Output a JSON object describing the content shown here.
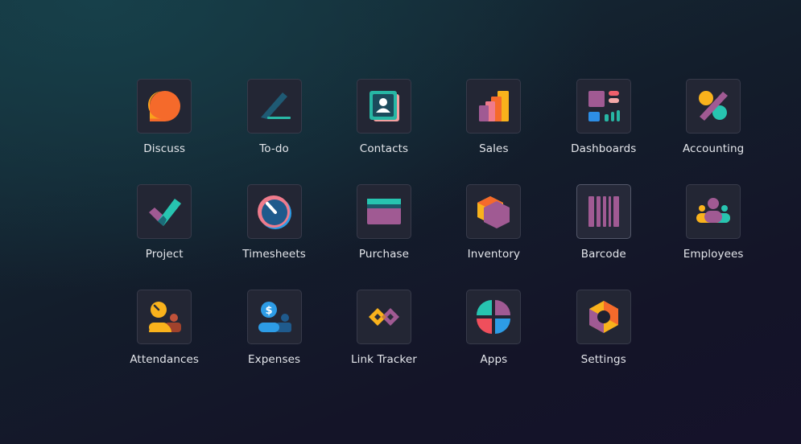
{
  "apps": [
    {
      "label": "Discuss",
      "icon": "discuss-icon"
    },
    {
      "label": "To-do",
      "icon": "todo-icon"
    },
    {
      "label": "Contacts",
      "icon": "contacts-icon"
    },
    {
      "label": "Sales",
      "icon": "sales-icon"
    },
    {
      "label": "Dashboards",
      "icon": "dashboards-icon"
    },
    {
      "label": "Accounting",
      "icon": "accounting-icon"
    },
    {
      "label": "Project",
      "icon": "project-icon"
    },
    {
      "label": "Timesheets",
      "icon": "timesheets-icon"
    },
    {
      "label": "Purchase",
      "icon": "purchase-icon"
    },
    {
      "label": "Inventory",
      "icon": "inventory-icon"
    },
    {
      "label": "Barcode",
      "icon": "barcode-icon"
    },
    {
      "label": "Employees",
      "icon": "employees-icon"
    },
    {
      "label": "Attendances",
      "icon": "attendances-icon"
    },
    {
      "label": "Expenses",
      "icon": "expenses-icon"
    },
    {
      "label": "Link Tracker",
      "icon": "link-tracker-icon"
    },
    {
      "label": "Apps",
      "icon": "apps-icon"
    },
    {
      "label": "Settings",
      "icon": "settings-icon"
    }
  ],
  "expenses_symbol": "$"
}
